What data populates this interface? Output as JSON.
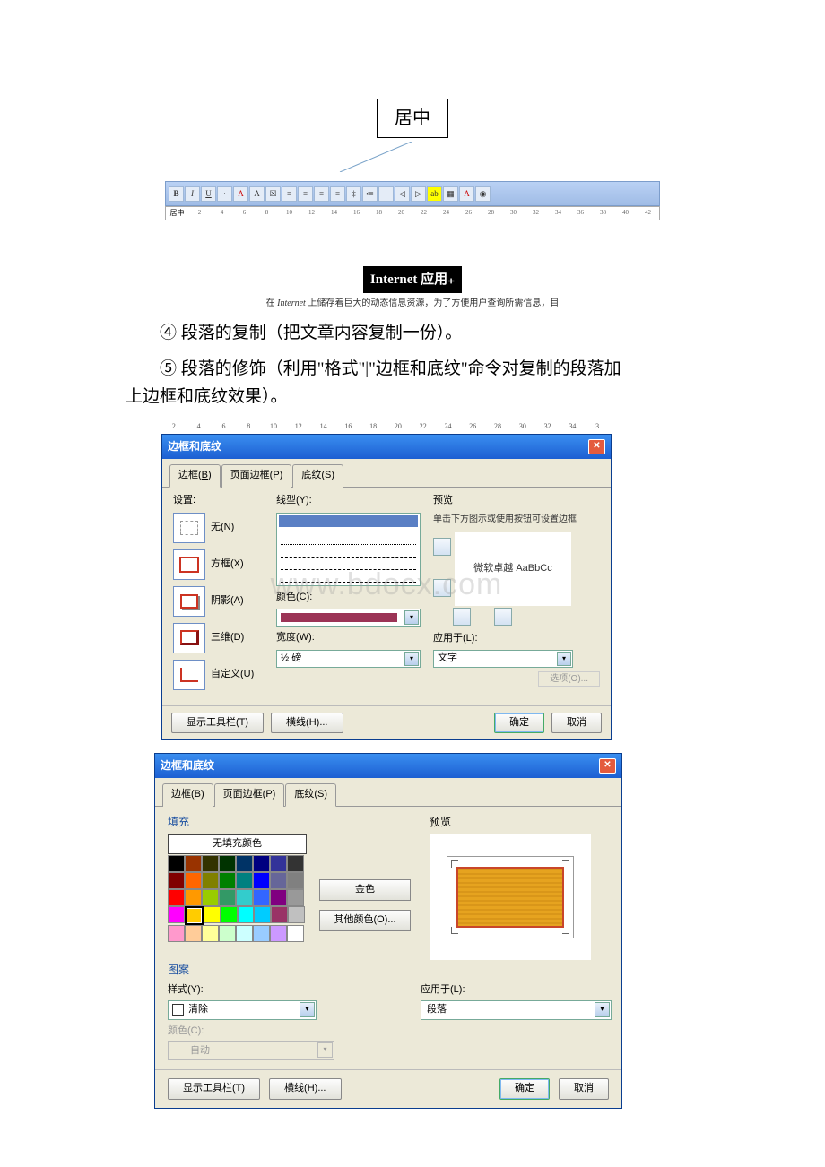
{
  "callout_box": "居中",
  "toolbar": {
    "zoom_label": "居中",
    "bold": "B",
    "italic": "I",
    "underline": "U",
    "a1": "A",
    "a2": "A"
  },
  "ruler1_ticks": [
    "2",
    "4",
    "6",
    "8",
    "10",
    "12",
    "14",
    "16",
    "18",
    "20",
    "22",
    "24",
    "26",
    "28",
    "30",
    "32",
    "34",
    "36",
    "38",
    "40",
    "42"
  ],
  "snippet": {
    "title": "Internet 应用",
    "para_prefix": "在 ",
    "para_em": "Internet",
    "para_rest": " 上储存着巨大的动态信息资源，为了方便用户查询所需信息，目"
  },
  "text4": "④ 段落的复制（把文章内容复制一份）。",
  "text5a": "⑤ 段落的修饰（利用\"格式\"|\"边框和底纹\"命令对复制的段落加",
  "text5b": "上边框和底纹效果）。",
  "ruler2_ticks": [
    "2",
    "4",
    "6",
    "8",
    "10",
    "12",
    "14",
    "16",
    "18",
    "20",
    "22",
    "24",
    "26",
    "28",
    "30",
    "32",
    "34",
    "3"
  ],
  "dlg1": {
    "title": "边框和底纹",
    "tabs": {
      "b": "边框(B)",
      "p": "页面边框(P)",
      "s": "底纹(S)"
    },
    "settings_label": "设置:",
    "none": "无(N)",
    "box": "方框(X)",
    "shadow": "阴影(A)",
    "threeD": "三维(D)",
    "custom": "自定义(U)",
    "linetype": "线型(Y):",
    "color": "颜色(C):",
    "width": "宽度(W):",
    "width_val": "½ 磅",
    "preview": "预览",
    "preview_desc": "单击下方图示或使用按钮可设置边框",
    "preview_text": "微软卓越  AaBbCc",
    "apply": "应用于(L):",
    "apply_val": "文字",
    "options": "选项(O)...",
    "show_toolbar": "显示工具栏(T)",
    "hline": "横线(H)...",
    "ok": "确定",
    "cancel": "取消"
  },
  "watermark": "www.bdocx.com",
  "dlg2": {
    "title": "边框和底纹",
    "tabs": {
      "b": "边框(B)",
      "p": "页面边框(P)",
      "s": "底纹(S)"
    },
    "fill": "填充",
    "nofill": "无填充颜色",
    "gold": "金色",
    "more_colors": "其他颜色(O)...",
    "preview": "预览",
    "pattern": "图案",
    "style": "样式(Y):",
    "style_val": "清除",
    "color": "颜色(C):",
    "color_val": "自动",
    "apply": "应用于(L):",
    "apply_val": "段落",
    "show_toolbar": "显示工具栏(T)",
    "hline": "横线(H)...",
    "ok": "确定",
    "cancel": "取消"
  }
}
